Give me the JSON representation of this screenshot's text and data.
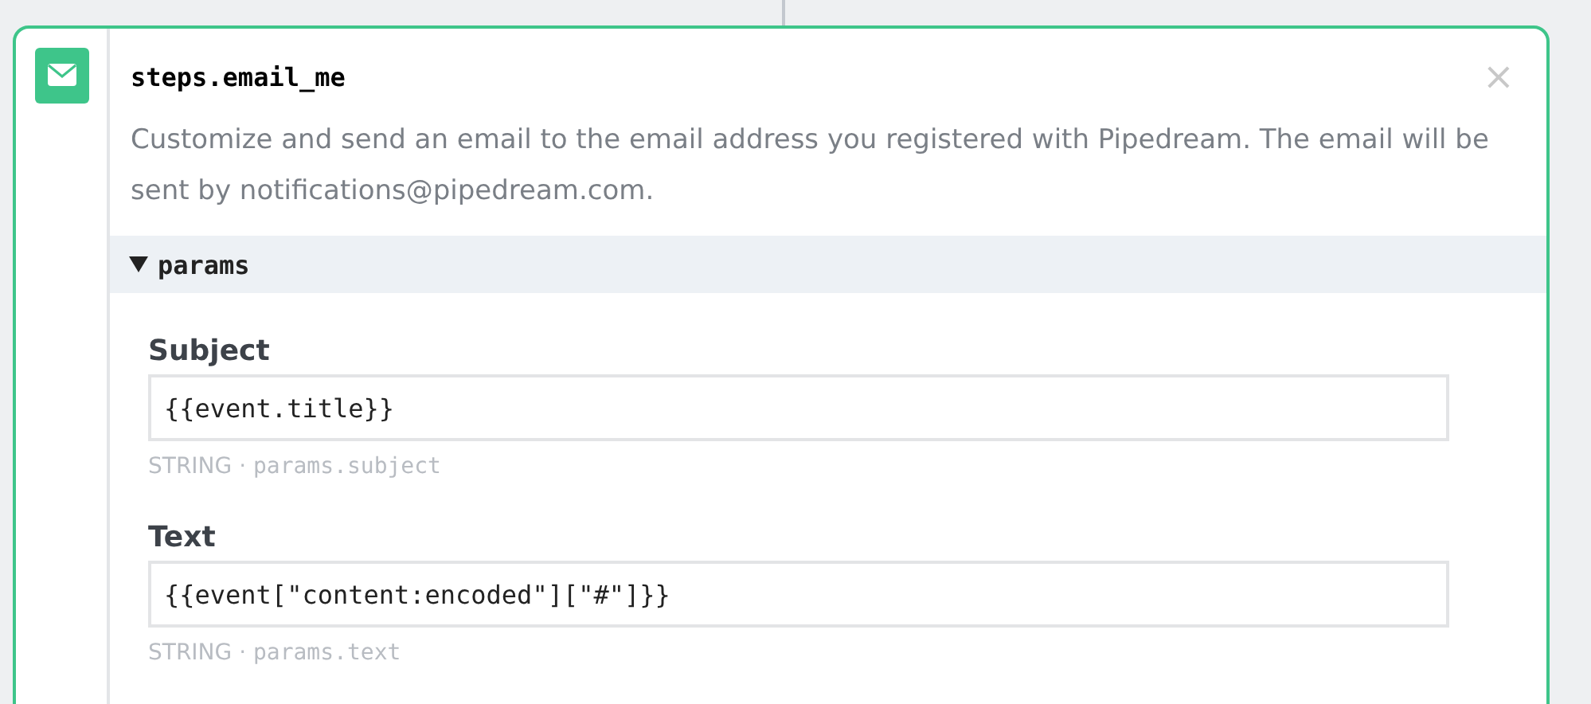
{
  "step": {
    "title": "steps.email_me",
    "close": "×",
    "description": "Customize and send an email to the email address you registered with Pipedream. The email will be sent by notifications@pipedream.com."
  },
  "params": {
    "label": "params",
    "expanded": true,
    "fields": [
      {
        "label": "Subject",
        "value": "{{event.title}}",
        "type": "STRING",
        "separator": "·",
        "path": "params.subject"
      },
      {
        "label": "Text",
        "value": "{{event[\"content:encoded\"][\"#\"]}}",
        "type": "STRING",
        "separator": "·",
        "path": "params.text"
      }
    ]
  }
}
